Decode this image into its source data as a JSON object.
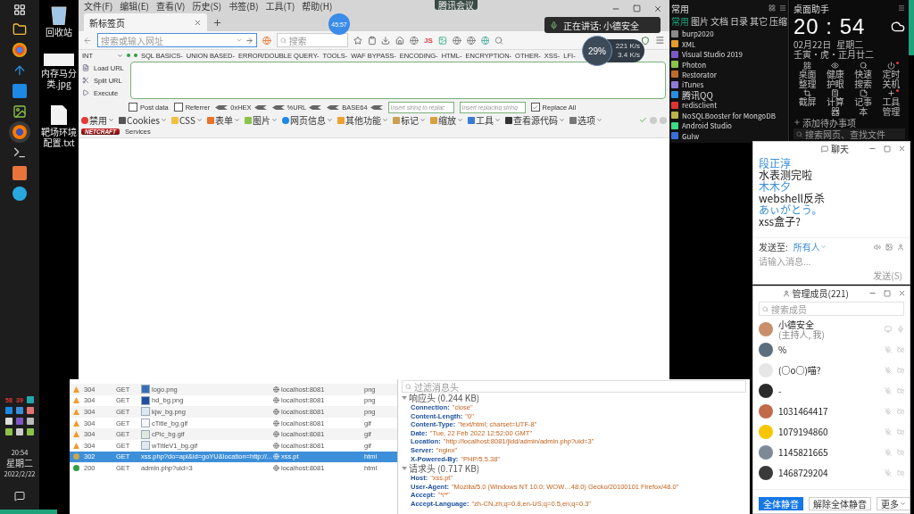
{
  "taskbar": {
    "tray_badges": [
      "58",
      "39"
    ],
    "clock": {
      "time": "20:54",
      "weekday": "星期二",
      "date": "2022/2/22"
    }
  },
  "desktop_icons": [
    {
      "label": "回收站",
      "kind": "bin"
    },
    {
      "label": "内存马分类.jpg",
      "kind": "image"
    },
    {
      "label": "靶场环境配置.txt",
      "kind": "text"
    }
  ],
  "browser": {
    "menu": [
      "文件(F)",
      "编辑(E)",
      "查看(V)",
      "历史(S)",
      "书签(B)",
      "工具(T)",
      "帮助(H)"
    ],
    "tab": {
      "title": "新标签页",
      "selected": true
    },
    "address_placeholder": "搜索或输入网址",
    "search_placeholder": "搜索",
    "toolbar_badge": "JS",
    "hackbar": {
      "select": "INT",
      "menus": [
        "SQL BASICS-",
        "UNION BASED-",
        "ERROR/DOUBLE QUERY-",
        "TOOLS-",
        "WAF BYPASS-",
        "ENCODING-",
        "HTML-",
        "ENCRYPTION-",
        "OTHER-",
        "XSS-",
        "LFI-"
      ],
      "actions": [
        {
          "label": "Load URL",
          "kind": "load"
        },
        {
          "label": "Split URL",
          "kind": "split"
        },
        {
          "label": "Execute",
          "kind": "execute"
        }
      ],
      "options": [
        {
          "kind": "checkbox",
          "label": "Post data",
          "checked": false
        },
        {
          "kind": "checkbox",
          "label": "Referrer",
          "checked": false
        },
        {
          "kind": "encoder",
          "label": "0xHEX"
        },
        {
          "kind": "encoder",
          "label": "%URL"
        },
        {
          "kind": "encoder",
          "label": "BASE64"
        }
      ],
      "replace_placeholder": "Insert string to replac",
      "replacing_placeholder": "Insert replacing string",
      "replace_all": {
        "label": "Replace All",
        "checked": true
      }
    },
    "webdev_menus": [
      "禁用",
      "Cookies",
      "CSS",
      "表单",
      "图片",
      "网页信息",
      "其他功能",
      "标记",
      "缩放",
      "工具",
      "查看源代码",
      "选项"
    ],
    "netcraft": {
      "logo": "NETCRAFT",
      "menu": "Services"
    }
  },
  "meeting": {
    "pill": "腾讯会议",
    "timer": "45:57",
    "speaking": "正在讲话: 小德安全"
  },
  "speed_meter": {
    "percent": "29%",
    "upload": "221 K/s",
    "download": "3.4 K/s"
  },
  "network": {
    "rows": [
      {
        "kind": "cached",
        "status": "304",
        "method": "GET",
        "file": "logo.png",
        "preview": true,
        "domain": "localhost:8081",
        "type": "png",
        "selected": false
      },
      {
        "kind": "cached",
        "status": "304",
        "method": "GET",
        "file": "hd_bg.png",
        "preview": true,
        "domain": "localhost:8081",
        "type": "png",
        "selected": false
      },
      {
        "kind": "cached",
        "status": "304",
        "method": "GET",
        "file": "kjw_bg.png",
        "preview": true,
        "domain": "localhost:8081",
        "type": "png",
        "selected": false
      },
      {
        "kind": "cached",
        "status": "304",
        "method": "GET",
        "file": "cTitle_bg.gif",
        "preview": true,
        "domain": "localhost:8081",
        "type": "gif",
        "selected": false
      },
      {
        "kind": "cached",
        "status": "304",
        "method": "GET",
        "file": "cPic_bg.gif",
        "preview": true,
        "domain": "localhost:8081",
        "type": "gif",
        "selected": false
      },
      {
        "kind": "cached",
        "status": "304",
        "method": "GET",
        "file": "wTitleV1_bg.gif",
        "preview": true,
        "domain": "localhost:8081",
        "type": "gif",
        "selected": false
      },
      {
        "kind": "redirect",
        "status": "302",
        "method": "GET",
        "file": "xss.php?do=api&id=goYU&location=http://...",
        "preview": false,
        "domain": "xss.pt",
        "type": "html",
        "selected": true
      },
      {
        "kind": "success",
        "status": "200",
        "method": "GET",
        "file": "admin.php?uid=3",
        "preview": false,
        "domain": "localhost:8081",
        "type": "html",
        "selected": false
      }
    ]
  },
  "headers": {
    "filter_placeholder": "过滤消息头",
    "sections": [
      {
        "title": "响应头 (0.244 KB)",
        "expanded": true,
        "items": [
          {
            "name": "Connection:",
            "value": "\"close\""
          },
          {
            "name": "Content-Length:",
            "value": "\"0\""
          },
          {
            "name": "Content-Type:",
            "value": "\"text/html; charset=UTF-8\""
          },
          {
            "name": "Date:",
            "value": "\"Tue, 22 Feb 2022 12:52:00 GMT\""
          },
          {
            "name": "Location:",
            "value": "\"http://localhost:8081/jldd/admin/admin.php?uid=3\""
          },
          {
            "name": "Server:",
            "value": "\"nginx\""
          },
          {
            "name": "X-Powered-By:",
            "value": "\"PHP/5.5.38\""
          }
        ]
      },
      {
        "title": "请求头 (0.717 KB)",
        "expanded": true,
        "items": [
          {
            "name": "Host:",
            "value": "\"xss.pt\""
          },
          {
            "name": "User-Agent:",
            "value": "\"Mozilla/5.0 (Windows NT 10.0; WOW…48.0) Gecko/20100101 Firefox/48.0\""
          },
          {
            "name": "Accept:",
            "value": "\"*/*\""
          },
          {
            "name": "Accept-Language:",
            "value": "\"zh-CN,zh;q=0.8,en-US;q=0.5,en;q=0.3\""
          }
        ]
      }
    ]
  },
  "apps_panel": {
    "title": "常用",
    "tabs": [
      {
        "label": "常用",
        "selected": true
      },
      {
        "label": "图片",
        "selected": false
      },
      {
        "label": "文档",
        "selected": false
      },
      {
        "label": "日录",
        "selected": false
      },
      {
        "label": "其它",
        "selected": false
      },
      {
        "label": "压缩",
        "selected": false
      }
    ],
    "items": [
      "burp2020",
      "XML",
      "Visual Studio 2019",
      "Photon",
      "Restorator",
      "iTunes",
      "腾讯QQ",
      "redisclient",
      "NoSQLBooster for MongoDB",
      "Android Studio",
      "Gulw"
    ]
  },
  "assistant": {
    "title": "桌面助手",
    "time": "20 : 54",
    "date": "02月22日",
    "weekday": "星期二",
    "lunar": "壬寅·虎·正月廿二",
    "tools": [
      {
        "label": "桌面整理",
        "kind": "desk",
        "badge": false
      },
      {
        "label": "健康护眼",
        "kind": "eye",
        "badge": false
      },
      {
        "label": "快速搜索",
        "kind": "search",
        "badge": false
      },
      {
        "label": "定时关机",
        "kind": "power",
        "badge": true
      },
      {
        "label": "截屏",
        "kind": "crop",
        "badge": false
      },
      {
        "label": "计算器",
        "kind": "calc",
        "badge": false
      },
      {
        "label": "记事本",
        "kind": "note",
        "badge": false
      },
      {
        "label": "工具管理",
        "kind": "plus",
        "badge": true
      }
    ],
    "todo": "添加待办事项",
    "search_placeholder": "搜索网页、查找文件"
  },
  "chat": {
    "title": "聊天",
    "messages": [
      {
        "kind": "sender",
        "text": "段正淳"
      },
      {
        "kind": "message",
        "text": "水表测完啦"
      },
      {
        "kind": "sender",
        "text": "木木夕"
      },
      {
        "kind": "message",
        "text": "webshell反杀"
      },
      {
        "kind": "sender",
        "text": "あぃがとう。"
      },
      {
        "kind": "message",
        "text": "xss盒子?"
      }
    ],
    "send_to_label": "发送至:",
    "recipient": "所有人",
    "input_placeholder": "请输入消息...",
    "send_button": "发送(S)"
  },
  "members": {
    "title": "管理成员(221)",
    "search_placeholder": "搜索成员",
    "list": [
      {
        "name": "小德安全",
        "note": "(主持人, 我)",
        "muted": false
      },
      {
        "name": "%",
        "muted": true
      },
      {
        "name": "(○o○)喵?",
        "muted": true
      },
      {
        "name": "-",
        "muted": true
      },
      {
        "name": "1031464417",
        "muted": true
      },
      {
        "name": "1079194860",
        "muted": true
      },
      {
        "name": "1145821665",
        "muted": true
      },
      {
        "name": "1468729204",
        "muted": true
      }
    ],
    "buttons": [
      {
        "label": "全体静音",
        "primary": true,
        "dropdown": false
      },
      {
        "label": "解除全体静音",
        "primary": false,
        "dropdown": false
      },
      {
        "label": "更多",
        "primary": false,
        "dropdown": true
      }
    ]
  }
}
